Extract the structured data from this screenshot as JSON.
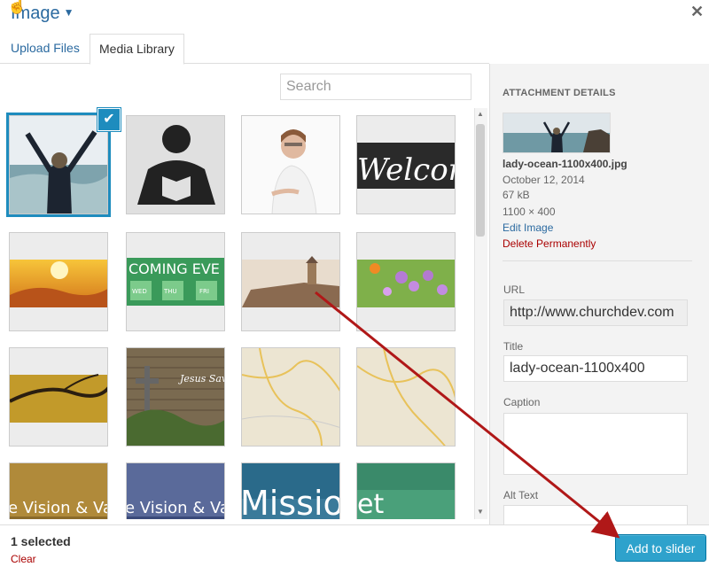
{
  "header": {
    "title": "Image",
    "close_glyph": "✕"
  },
  "tabs": [
    {
      "label": "Upload Files"
    },
    {
      "label": "Media Library"
    }
  ],
  "search": {
    "placeholder": "Search",
    "value": ""
  },
  "grid": {
    "selected_index": 0,
    "thumbs": [
      {
        "name": "lady-ocean",
        "overlay": ""
      },
      {
        "name": "reader-icon",
        "overlay": ""
      },
      {
        "name": "woman-portrait",
        "overlay": ""
      },
      {
        "name": "welcome-banner",
        "overlay": "Welcome"
      },
      {
        "name": "sunrise",
        "overlay": ""
      },
      {
        "name": "coming-events",
        "overlay": "COMING EVE",
        "days": [
          "WED",
          "THU",
          "FRI"
        ]
      },
      {
        "name": "church-building",
        "overlay": ""
      },
      {
        "name": "flowers",
        "overlay": ""
      },
      {
        "name": "tree-branches",
        "overlay": ""
      },
      {
        "name": "jesus-saves",
        "overlay": "Jesus Save"
      },
      {
        "name": "map-1",
        "overlay": ""
      },
      {
        "name": "map-2",
        "overlay": ""
      },
      {
        "name": "vision-values-1",
        "overlay": "e Vision & Value"
      },
      {
        "name": "vision-values-2",
        "overlay": "e Vision & Value"
      },
      {
        "name": "mission",
        "overlay": "Missio"
      },
      {
        "name": "et-banner",
        "overlay": "et"
      }
    ]
  },
  "attachment": {
    "heading": "ATTACHMENT DETAILS",
    "filename": "lady-ocean-1100x400.jpg",
    "date": "October 12, 2014",
    "size": "67 kB",
    "dimensions": "1100 × 400",
    "edit_link": "Edit Image",
    "delete_link": "Delete Permanently",
    "url_label": "URL",
    "url_value": "http://www.churchdev.com",
    "title_label": "Title",
    "title_value": "lady-ocean-1100x400",
    "caption_label": "Caption",
    "caption_value": "",
    "alt_label": "Alt Text",
    "alt_value": ""
  },
  "footer": {
    "selected_text": "1 selected",
    "clear_label": "Clear",
    "add_button": "Add to slider"
  },
  "colors": {
    "accent": "#2ea2cc",
    "link": "#2b6aa0",
    "danger": "#aa0000",
    "arrow": "#b01818"
  }
}
